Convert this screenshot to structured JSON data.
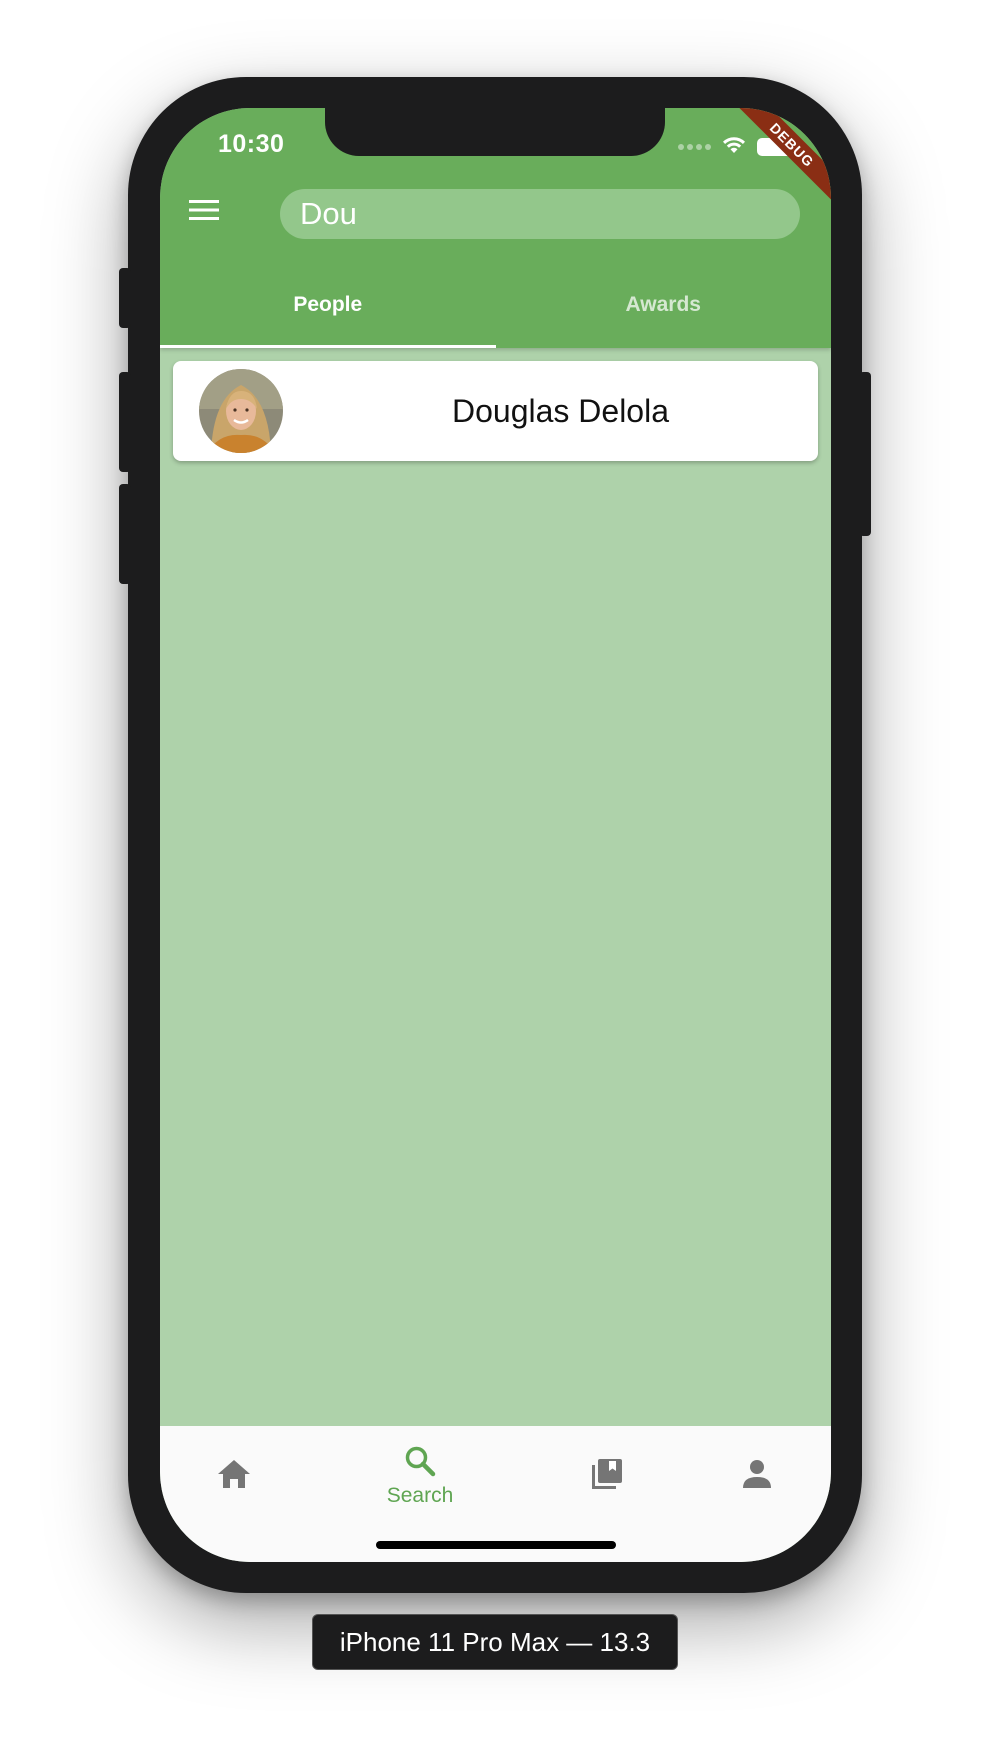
{
  "status_bar": {
    "time": "10:30"
  },
  "debug_banner": "DEBUG",
  "app_bar": {
    "menu_icon": "menu-icon",
    "search": {
      "value": "Dou"
    },
    "tabs": [
      {
        "label": "People",
        "active": true
      },
      {
        "label": "Awards",
        "active": false
      }
    ]
  },
  "results": [
    {
      "name": "Douglas Delola",
      "avatar": "profile-photo"
    }
  ],
  "bottom_nav": {
    "items": [
      {
        "icon": "home-icon",
        "label": "",
        "active": false
      },
      {
        "icon": "search-icon",
        "label": "Search",
        "active": true
      },
      {
        "icon": "library-books-icon",
        "label": "",
        "active": false
      },
      {
        "icon": "person-icon",
        "label": "",
        "active": false
      }
    ]
  },
  "device_caption": "iPhone 11 Pro Max — 13.3",
  "colors": {
    "primary": "#69ad5b",
    "search_field": "#93c78b",
    "background": "#aed2aa",
    "active_nav": "#5fa552",
    "inactive_nav": "#757575",
    "debug_banner": "#8a2e14"
  }
}
